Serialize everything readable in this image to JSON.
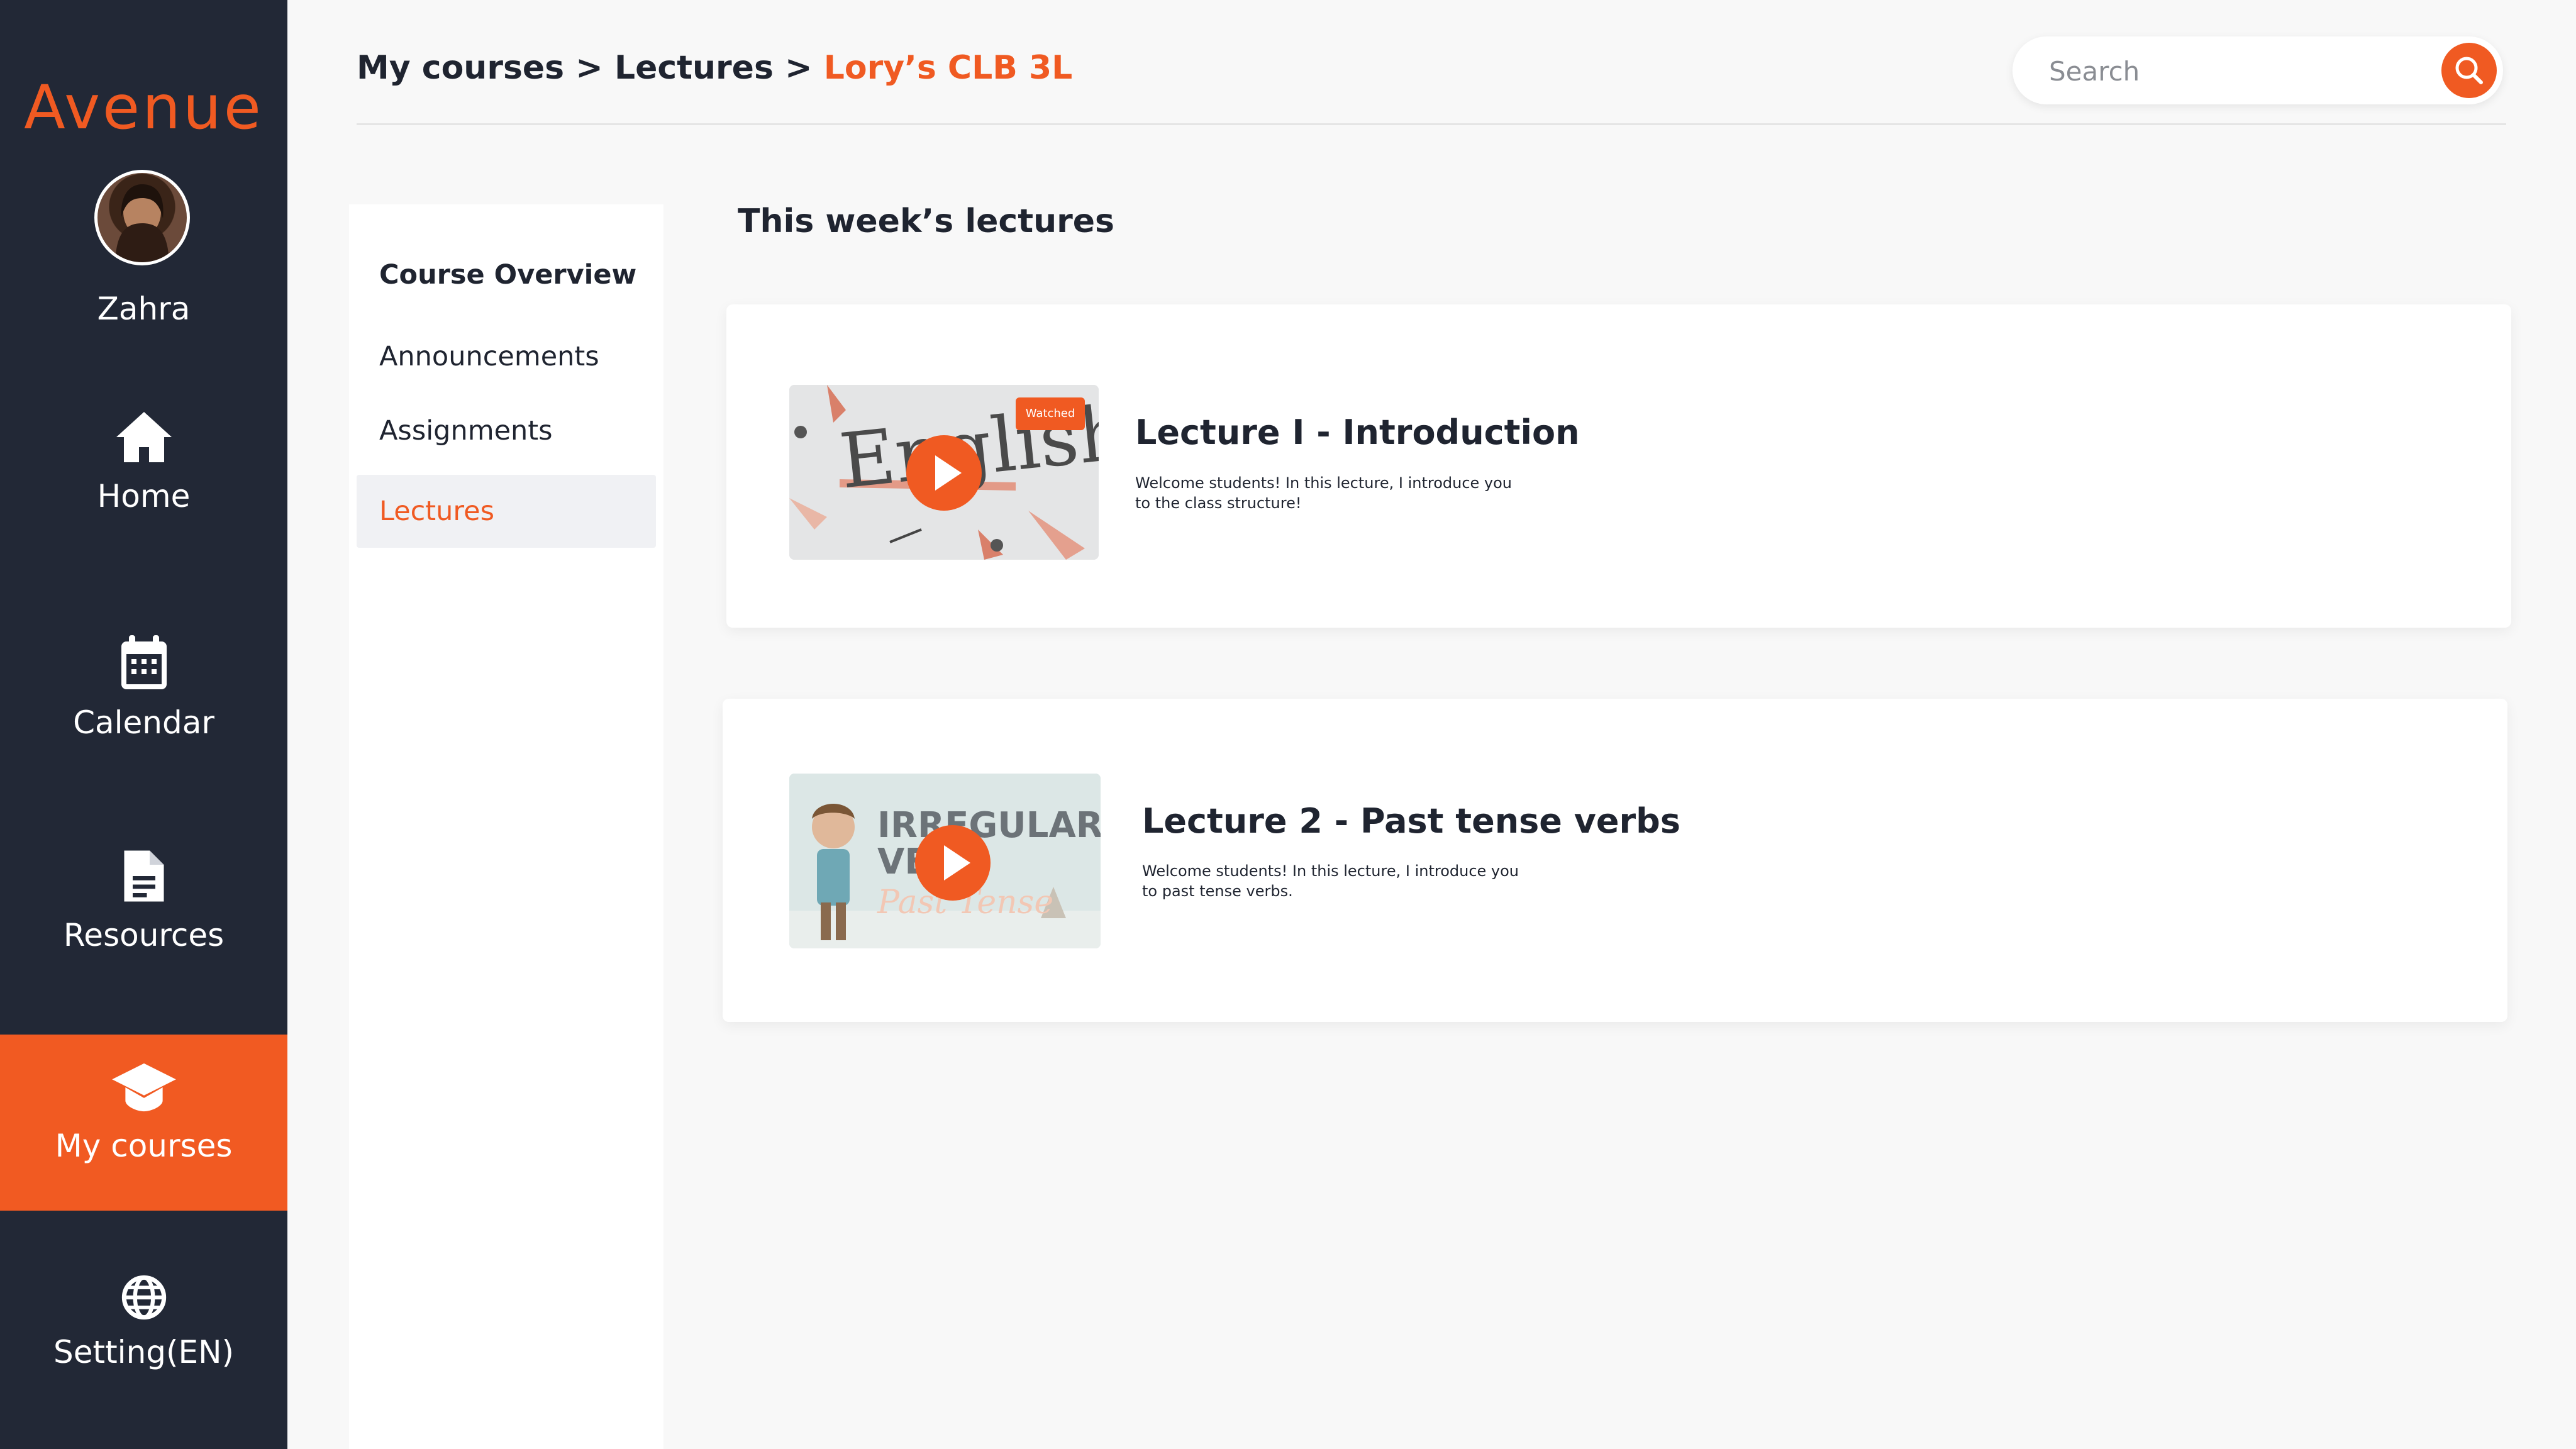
{
  "sidebar": {
    "logo": "Avenue",
    "user_name": "Zahra",
    "items": [
      {
        "label": "Home",
        "icon": "home-icon"
      },
      {
        "label": "Calendar",
        "icon": "calendar-icon"
      },
      {
        "label": "Resources",
        "icon": "document-icon"
      },
      {
        "label": "My courses",
        "icon": "graduation-cap-icon",
        "active": true
      },
      {
        "label": "Setting(EN)",
        "icon": "globe-icon"
      }
    ]
  },
  "header": {
    "breadcrumb": [
      {
        "label": "My courses"
      },
      {
        "label": "Lectures"
      },
      {
        "label": "Lory’s CLB 3L"
      }
    ],
    "separator": ">",
    "search": {
      "placeholder": "Search",
      "value": ""
    }
  },
  "course_nav": {
    "items": [
      {
        "label": "Course Overview",
        "active": false
      },
      {
        "label": "Announcements",
        "active": false
      },
      {
        "label": "Assignments",
        "active": false
      },
      {
        "label": "Lectures",
        "active": true
      }
    ]
  },
  "main": {
    "section_title": "This week’s lectures",
    "lectures": [
      {
        "title": "Lecture I - Introduction",
        "description": "Welcome students! In this lecture, I introduce you to the class structure!",
        "badge": "Watched",
        "thumbnail_text": "English"
      },
      {
        "title": "Lecture 2 - Past tense verbs",
        "description": "Welcome students! In this lecture, I introduce you to past tense verbs.",
        "thumbnail_text_1": "IRREGULAR",
        "thumbnail_text_2": "VE",
        "thumbnail_text_3": "Past Tense"
      }
    ]
  },
  "colors": {
    "accent": "#F05A22",
    "sidebar_bg": "#222836",
    "page_bg": "#F8F8F8"
  }
}
